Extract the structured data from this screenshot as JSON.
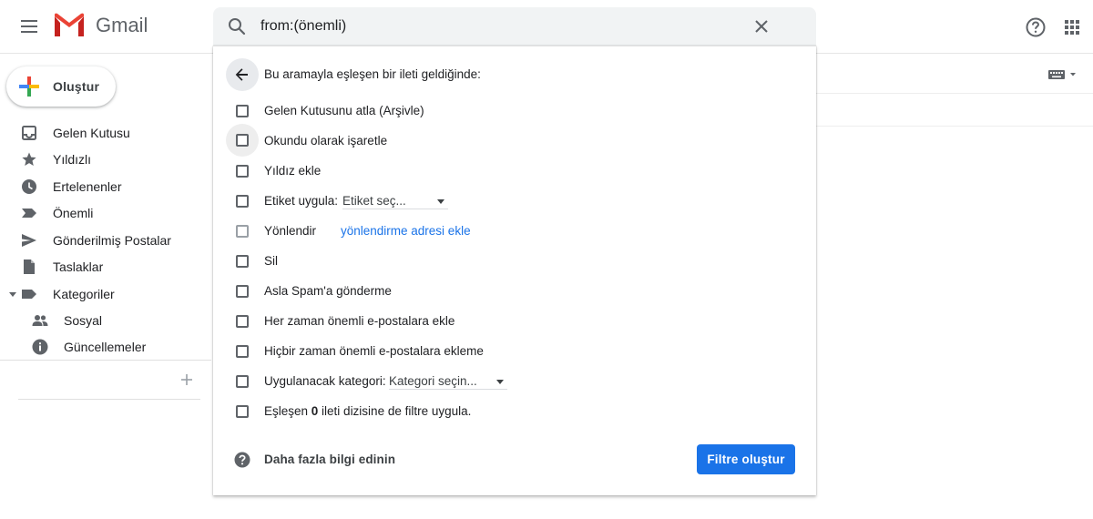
{
  "header": {
    "app_name": "Gmail",
    "search_query": "from:(önemli)"
  },
  "sidebar": {
    "compose_label": "Oluştur",
    "items": [
      {
        "label": "Gelen Kutusu",
        "icon": "inbox-icon"
      },
      {
        "label": "Yıldızlı",
        "icon": "star-icon"
      },
      {
        "label": "Ertelenenler",
        "icon": "clock-icon"
      },
      {
        "label": "Önemli",
        "icon": "important-icon"
      },
      {
        "label": "Gönderilmiş Postalar",
        "icon": "send-icon"
      },
      {
        "label": "Taslaklar",
        "icon": "draft-icon"
      },
      {
        "label": "Kategoriler",
        "icon": "label-icon"
      },
      {
        "label": "Sosyal",
        "icon": "people-icon"
      },
      {
        "label": "Güncellemeler",
        "icon": "info-icon"
      }
    ]
  },
  "filter_panel": {
    "title": "Bu aramayla eşleşen bir ileti geldiğinde:",
    "options": {
      "skip_inbox": "Gelen Kutusunu atla (Arşivle)",
      "mark_read": "Okundu olarak işaretle",
      "star_it": "Yıldız ekle",
      "apply_label": "Etiket uygula:",
      "label_select": "Etiket seç...",
      "forward": "Yönlendir",
      "forward_link": "yönlendirme adresi ekle",
      "delete": "Sil",
      "never_spam": "Asla Spam'a gönderme",
      "always_important": "Her zaman önemli e-postalara ekle",
      "never_important": "Hiçbir zaman önemli e-postalara ekleme",
      "category": "Uygulanacak kategori:",
      "category_select": "Kategori seçin...",
      "apply_matching_pre": "Eşleşen ",
      "apply_matching_count": "0",
      "apply_matching_post": " ileti dizisine de filtre uygula."
    },
    "learn_more": "Daha fazla bilgi edinin",
    "create_button": "Filtre oluştur"
  },
  "colors": {
    "accent": "#1a73e8",
    "icon_gray": "#5f6368",
    "checkbox_border": "#5f6368"
  }
}
